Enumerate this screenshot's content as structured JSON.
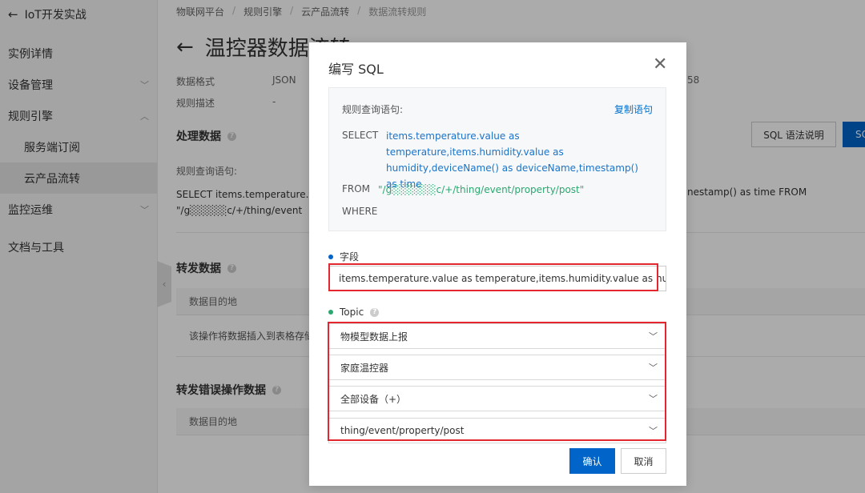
{
  "sidebar": {
    "back_label": "IoT开发实战",
    "items": [
      {
        "label": "实例详情"
      },
      {
        "label": "设备管理"
      },
      {
        "label": "规则引擎"
      },
      {
        "label": "服务端订阅"
      },
      {
        "label": "云产品流转"
      },
      {
        "label": "监控运维"
      },
      {
        "label": "文档与工具"
      }
    ]
  },
  "breadcrumb": [
    "物联网平台",
    "规则引擎",
    "云产品流转",
    "数据流转规则"
  ],
  "page": {
    "title": "温控器数据流转",
    "meta": [
      {
        "key": "数据格式",
        "value": "JSON"
      },
      {
        "key": "规则描述",
        "value": "-"
      }
    ],
    "meta_right_value": "58",
    "process_section": "处理数据",
    "query_label": "规则查询语句:",
    "sql_line1": "SELECT items.temperature.va",
    "sql_line2": "\"/g░░░░░c/+/thing/event",
    "sql_line1_right": "nestamp() as time FROM",
    "sql_help_button": "SQL 语法说明",
    "blue_button_partial": "SQ",
    "forward_section": "转发数据",
    "forward_table_header": "数据目的地",
    "forward_table_row": "该操作将数据插入到表格存储",
    "error_section": "转发错误操作数据",
    "error_table_header": "数据目的地"
  },
  "modal": {
    "title": "编写 SQL",
    "query_label": "规则查询语句:",
    "copy_link": "复制语句",
    "select_kw": "SELECT",
    "select_val": "items.temperature.value as temperature,items.humidity.value as humidity,deviceName() as deviceName,timestamp() as time",
    "from_kw": "FROM",
    "from_val": "\"/g░░░░░░c/+/thing/event/property/post\"",
    "where_kw": "WHERE",
    "field_label": "字段",
    "field_value": "items.temperature.value as temperature,items.humidity.value as humidity",
    "topic_label": "Topic",
    "topic_selects": [
      "物模型数据上报",
      "家庭温控器",
      "全部设备（+）",
      "thing/event/property/post"
    ],
    "confirm": "确认",
    "cancel": "取消"
  },
  "colors": {
    "primary": "#0064c8",
    "highlight_red": "#e3262f",
    "sql_blue": "#1a73c8",
    "sql_green": "#2aa86f",
    "field_dot": "#0064c8",
    "topic_dot": "#2aa86f"
  }
}
